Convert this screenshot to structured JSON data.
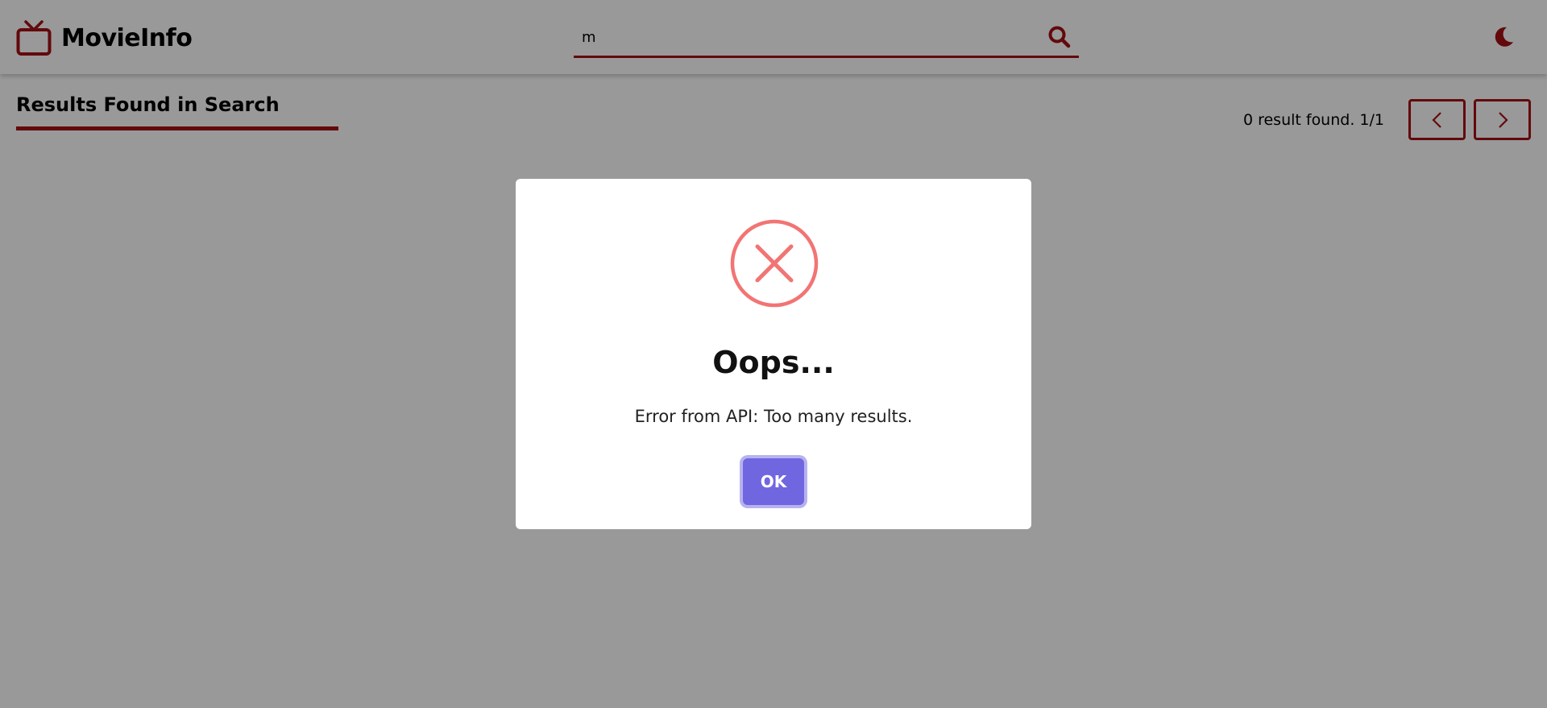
{
  "app": {
    "name": "MovieInfo",
    "accent_color": "#a50f14"
  },
  "header": {
    "logo_icon": "tv-icon",
    "search": {
      "value": "m",
      "button_icon": "search-icon"
    },
    "theme_toggle_icon": "moon-icon"
  },
  "results": {
    "title": "Results Found in Search",
    "count_text": "0 result found. 1/1",
    "prev_icon": "chevron-left-icon",
    "next_icon": "chevron-right-icon"
  },
  "modal": {
    "icon": "error-x-icon",
    "icon_color": "#f27474",
    "title": "Oops...",
    "message": "Error from API: Too many results.",
    "confirm_label": "OK",
    "confirm_color": "#7066e0"
  }
}
